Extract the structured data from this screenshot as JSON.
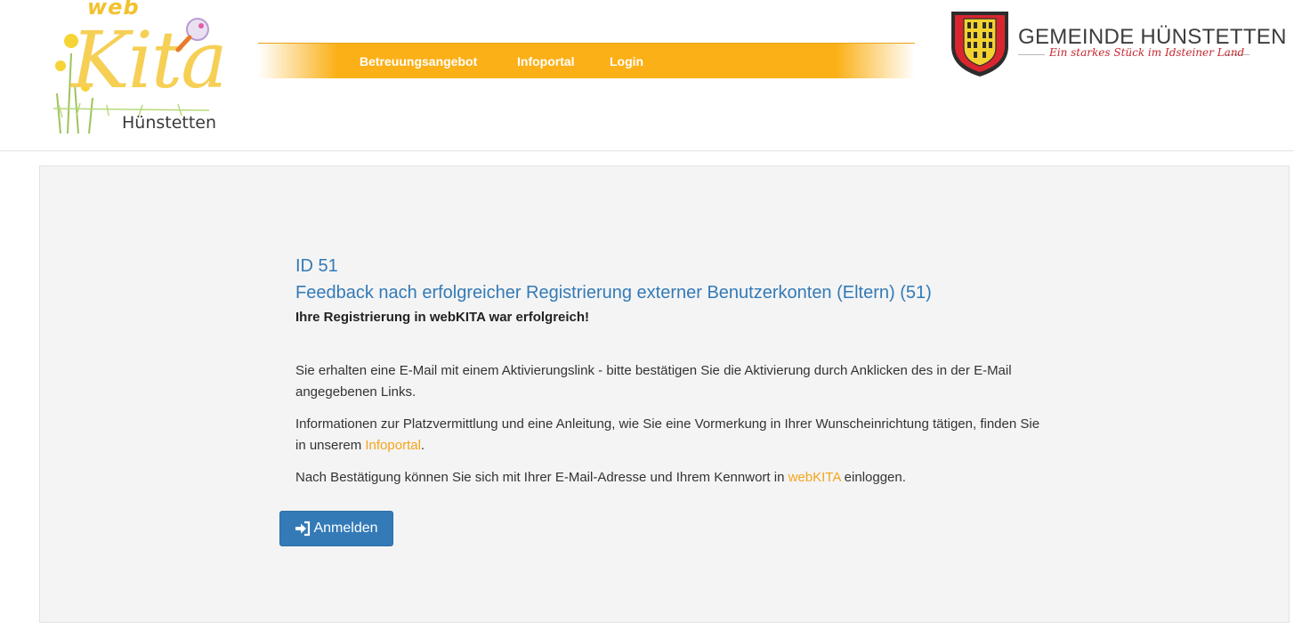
{
  "header": {
    "logo": {
      "web": "web",
      "kita": "Kita",
      "town": "Hünstetten"
    },
    "nav": {
      "items": [
        {
          "label": "Betreuungsangebot"
        },
        {
          "label": "Infoportal"
        },
        {
          "label": "Login"
        }
      ]
    },
    "municipality": {
      "name": "GEMEINDE HÜNSTETTEN",
      "slogan": "Ein starkes Stück im Idsteiner Land"
    }
  },
  "main": {
    "id_line": "ID 51",
    "title": "Feedback nach erfolgreicher Registrierung externer Benutzerkonten (Eltern) (51)",
    "success_message": "Ihre Registrierung in webKITA war erfolgreich!",
    "paragraph1": "Sie erhalten eine E-Mail mit einem Aktivierungslink - bitte bestätigen Sie die Aktivierung durch Anklicken des in der E-Mail angegebenen Links.",
    "paragraph2": {
      "before": "Informationen zur Platzvermittlung und eine Anleitung, wie Sie eine Vormerkung in Ihrer Wunscheinrichtung tätigen, finden Sie in unserem ",
      "link": "Infoportal",
      "after": "."
    },
    "paragraph3": {
      "before": "Nach Bestätigung können Sie sich mit Ihrer E-Mail-Adresse und Ihrem Kennwort in ",
      "link": "webKITA",
      "after": " einloggen."
    },
    "login_button": {
      "label": "Anmelden",
      "icon": "sign-in-icon"
    }
  },
  "colors": {
    "nav_bar": "#fbb017",
    "link": "#f4a51c",
    "heading": "#337ab7",
    "button": "#337ab7",
    "panel": "#f4f4f4",
    "slogan": "#c4262e"
  }
}
